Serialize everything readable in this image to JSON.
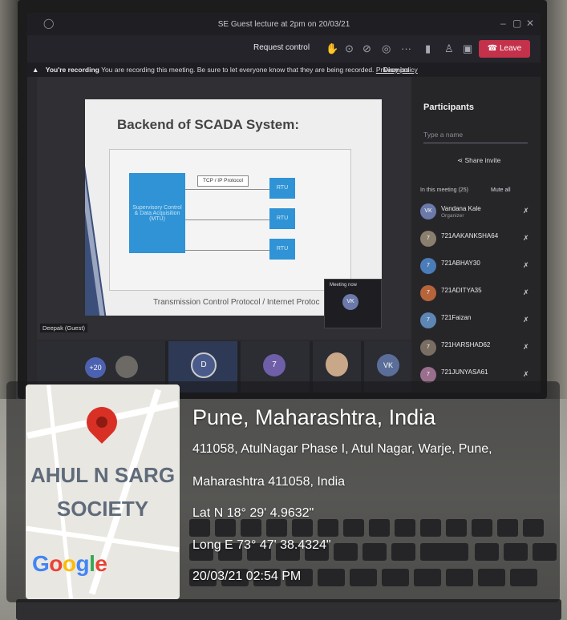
{
  "meeting": {
    "window_title": "SE Guest lecture at 2pm on 20/03/21",
    "request_control": "Request control",
    "leave_label": "Leave",
    "recording_banner": {
      "title": "You're recording",
      "message": "You are recording this meeting. Be sure to let everyone know that they are being recorded.",
      "privacy_link": "Privacy policy",
      "dismiss": "Dismiss"
    },
    "slide": {
      "heading": "Backend of SCADA System:",
      "mtu_label": "Supervisory Control & Data Acquisition (MTU)",
      "protocol_label": "TCP / IP Protocol",
      "rtu_labels": [
        "RTU",
        "RTU",
        "RTU"
      ],
      "caption": "Transmission Control Protocol / Internet Protoc"
    },
    "presenter_label": "Deepak (Guest)",
    "mini_window": {
      "title": "Meeting now",
      "initials": "VK"
    },
    "participants": {
      "title": "Participants",
      "search_placeholder": "Type a name",
      "share_invite": "Share invite",
      "in_meeting": "In this meeting (25)",
      "mute_all": "Mute all",
      "list": [
        {
          "initials": "VK",
          "name": "Vandana Kale",
          "role": "Organizer"
        },
        {
          "initials": "7",
          "name": "721AAKANKSHA64",
          "role": ""
        },
        {
          "initials": "7",
          "name": "721ABHAY30",
          "role": ""
        },
        {
          "initials": "7",
          "name": "721ADITYA35",
          "role": ""
        },
        {
          "initials": "7",
          "name": "721Faizan",
          "role": ""
        },
        {
          "initials": "7",
          "name": "721HARSHAD62",
          "role": ""
        },
        {
          "initials": "7",
          "name": "721JUNYASA61",
          "role": ""
        }
      ]
    },
    "gallery": {
      "overflow": "+20",
      "tiles": [
        "D",
        "7",
        "VK"
      ]
    }
  },
  "geotag": {
    "place": "Pune, Maharashtra, India",
    "address_line1": "411058, AtulNagar Phase I, Atul Nagar, Warje, Pune,",
    "address_line2": "Maharashtra 411058, India",
    "lat": "Lat N 18° 29' 4.9632\"",
    "long": "Long E 73° 47' 38.4324\"",
    "datetime": "20/03/21 02:54 PM",
    "map_label_line1": "AHUL N SARG",
    "map_label_line2": "SOCIETY",
    "map_provider": "Google",
    "colors": {
      "pin": "#d93025",
      "overlay": "#1a1a1c"
    }
  }
}
